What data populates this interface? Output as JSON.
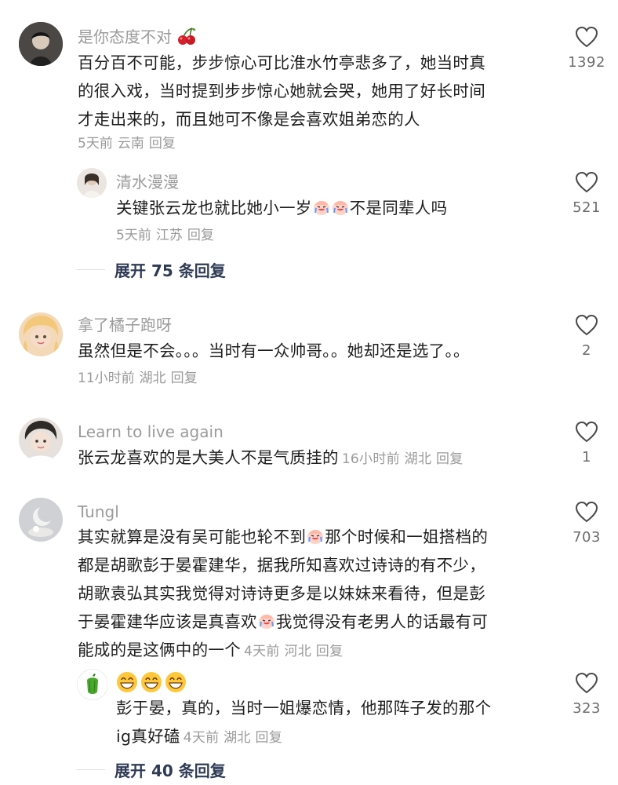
{
  "comments": [
    {
      "username": "是你态度不对",
      "username_emoji": "cherry-emoji",
      "text": "百分百不可能，步步惊心可比淮水竹亭悲多了，她当时真的很入戏，当时提到步步惊心她就会哭，她用了好长时间才走出来的，而且她可不像是会喜欢姐弟恋的人",
      "lines": [
        "百分百不可能，步步惊心可比淮水竹亭悲多了，她当时真",
        "的很入戏，当时提到步步惊心她就会哭，她用了好长时间",
        "才走出来的，而且她可不像是会喜欢姐弟恋的人"
      ],
      "time": "5天前",
      "location": "云南",
      "reply": "回复",
      "likes": "1392",
      "replies": [
        {
          "username": "清水漫漫",
          "text_before": "关键张云龙也就比她小一岁",
          "text_after": "不是同辈人吗",
          "time": "5天前",
          "location": "江苏",
          "reply": "回复",
          "likes": "521"
        }
      ],
      "expand": "展开 75 条回复"
    },
    {
      "username": "拿了橘子跑呀",
      "text": "虽然但是不会。。。当时有一众帅哥。。她却还是选了。。",
      "time": "11小时前",
      "location": "湖北",
      "reply": "回复",
      "likes": "2"
    },
    {
      "username": "Learn to live again",
      "text": "张云龙喜欢的是大美人不是气质挂的",
      "time": "16小时前",
      "location": "湖北",
      "reply": "回复",
      "likes": "1"
    },
    {
      "username": "Tungl",
      "line1_before": "其实就算是没有吴可能也轮不到",
      "line1_after": "那个时候和一姐搭档的",
      "line2": "都是胡歌彭于晏霍建华，据我所知喜欢过诗诗的有不少，",
      "line3": "胡歌袁弘其实我觉得对诗诗更多是以妹妹来看待，但是彭",
      "line4_before": "于晏霍建华应该是真喜欢",
      "line4_after": "我觉得没有老男人的话最有可",
      "line5": "能成的是这俩中的一个",
      "time": "4天前",
      "location": "河北",
      "reply": "回复",
      "likes": "703",
      "replies": [
        {
          "username_emojis": [
            "grinning-emoji",
            "grinning-emoji",
            "grinning-emoji"
          ],
          "line1": "彭于晏，真的，当时一姐爆恋情，他那阵子发的那个",
          "line2": "ig真好磕",
          "time": "4天前",
          "location": "湖北",
          "reply": "回复",
          "likes": "323"
        }
      ],
      "expand": "展开 40 条回复"
    }
  ],
  "colors": {
    "username": "#9b9b9b",
    "text": "#1e1e1e",
    "meta": "#9a9a9a",
    "expand": "#2f3b55"
  }
}
